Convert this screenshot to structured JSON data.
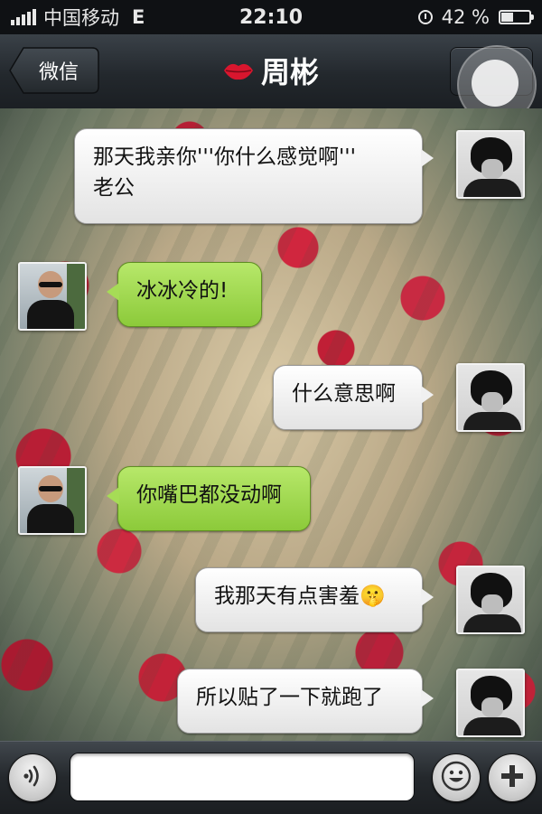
{
  "status_bar": {
    "carrier": "中国移动",
    "network": "E",
    "time": "22:10",
    "battery_percent": "42 %",
    "battery_level": 0.42,
    "icons": [
      "signal-bars-icon",
      "clock-icon",
      "battery-icon"
    ]
  },
  "nav": {
    "back_label": "微信",
    "title_icon": "lips-icon",
    "title": "周彬",
    "right_button_icon": "profile-icon"
  },
  "messages": [
    {
      "side": "right",
      "sender": "me",
      "lines": [
        "那天我亲你'''你什么感觉啊'''",
        "老公"
      ]
    },
    {
      "side": "left",
      "sender": "other",
      "lines": [
        "冰冰冷的!"
      ]
    },
    {
      "side": "right",
      "sender": "me",
      "lines": [
        "什么意思啊"
      ]
    },
    {
      "side": "left",
      "sender": "other",
      "lines": [
        "你嘴巴都没动啊"
      ]
    },
    {
      "side": "right",
      "sender": "me",
      "lines": [
        "我那天有点害羞"
      ],
      "emoji": "🤫"
    },
    {
      "side": "right",
      "sender": "me",
      "lines": [
        "所以贴了一下就跑了"
      ]
    }
  ],
  "input_bar": {
    "voice_icon": "voice-icon",
    "text_value": "",
    "emoji_icon": "smiley-icon",
    "plus_icon": "plus-icon"
  },
  "colors": {
    "my_bubble": "#ffffff",
    "their_bubble": "#a6dc56",
    "nav_bar": "#23282d"
  }
}
